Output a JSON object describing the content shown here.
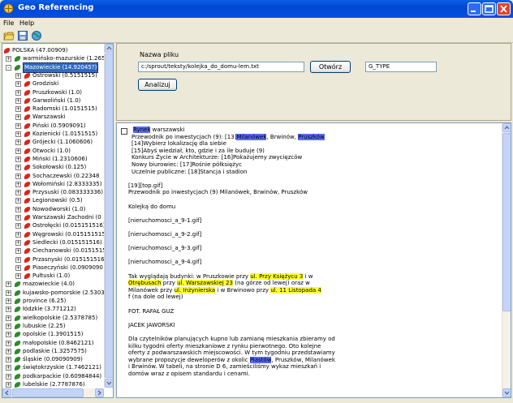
{
  "window": {
    "title": "Geo Referencing"
  },
  "menu": {
    "file": "File",
    "help": "Help"
  },
  "toolbar": {
    "icons": [
      "open-folder-icon",
      "save-icon",
      "globe-icon"
    ]
  },
  "tree": {
    "rows": [
      {
        "label": "POLSKA (47.00909)",
        "level": 0,
        "expander": "",
        "selected": false,
        "icon": "red"
      },
      {
        "label": "warmińsko-mazurskie (1.265",
        "level": 1,
        "expander": "+",
        "selected": false,
        "icon": "green"
      },
      {
        "label": "Mazowieckie (14.92045?)",
        "level": 1,
        "expander": "-",
        "selected": true,
        "icon": "green"
      },
      {
        "label": "Ostrowski (0.5151515)",
        "level": 2,
        "expander": "+",
        "selected": false,
        "icon": "red"
      },
      {
        "label": "Grodziski",
        "level": 2,
        "expander": "+",
        "selected": false,
        "icon": "red"
      },
      {
        "label": "Pruszkowski (1.0)",
        "level": 2,
        "expander": "+",
        "selected": false,
        "icon": "red"
      },
      {
        "label": "Garwoliński (1.0)",
        "level": 2,
        "expander": "+",
        "selected": false,
        "icon": "red"
      },
      {
        "label": "Radomski (1.0151515)",
        "level": 2,
        "expander": "+",
        "selected": false,
        "icon": "red"
      },
      {
        "label": "Warszawski",
        "level": 2,
        "expander": "+",
        "selected": false,
        "icon": "red"
      },
      {
        "label": "Piński (0.5909091)",
        "level": 2,
        "expander": "+",
        "selected": false,
        "icon": "red"
      },
      {
        "label": "Kozienicki (1.0151515)",
        "level": 2,
        "expander": "+",
        "selected": false,
        "icon": "red"
      },
      {
        "label": "Grójecki (1.1060606)",
        "level": 2,
        "expander": "+",
        "selected": false,
        "icon": "red"
      },
      {
        "label": "Otwocki (1.0)",
        "level": 2,
        "expander": "+",
        "selected": false,
        "icon": "red"
      },
      {
        "label": "Miński (1.2310606)",
        "level": 2,
        "expander": "+",
        "selected": false,
        "icon": "red"
      },
      {
        "label": "Sokołowski (0.125)",
        "level": 2,
        "expander": "+",
        "selected": false,
        "icon": "red"
      },
      {
        "label": "Sochaczewski (0.22348",
        "level": 2,
        "expander": "+",
        "selected": false,
        "icon": "red"
      },
      {
        "label": "Wołomiński (2.8333335)",
        "level": 2,
        "expander": "+",
        "selected": false,
        "icon": "red"
      },
      {
        "label": "Przysuski (0.083333336)",
        "level": 2,
        "expander": "+",
        "selected": false,
        "icon": "red"
      },
      {
        "label": "Legionowski (0.5)",
        "level": 2,
        "expander": "+",
        "selected": false,
        "icon": "red"
      },
      {
        "label": "Nowodworski (1.0)",
        "level": 2,
        "expander": "+",
        "selected": false,
        "icon": "red"
      },
      {
        "label": "Warszawski Zachodni (0",
        "level": 2,
        "expander": "+",
        "selected": false,
        "icon": "red"
      },
      {
        "label": "Ostrołęcki (0.015151516)",
        "level": 2,
        "expander": "+",
        "selected": false,
        "icon": "red"
      },
      {
        "label": "Węgrowski (0.015151515",
        "level": 2,
        "expander": "+",
        "selected": false,
        "icon": "red"
      },
      {
        "label": "Siedlecki (0.015151516)",
        "level": 2,
        "expander": "+",
        "selected": false,
        "icon": "red"
      },
      {
        "label": "Ciechanowski (0.0151515",
        "level": 2,
        "expander": "+",
        "selected": false,
        "icon": "red"
      },
      {
        "label": "Przasnyski (0.015151516",
        "level": 2,
        "expander": "+",
        "selected": false,
        "icon": "red"
      },
      {
        "label": "Piaseczyński (0.0909090",
        "level": 2,
        "expander": "+",
        "selected": false,
        "icon": "red"
      },
      {
        "label": "Pułtuski (1.0)",
        "level": 2,
        "expander": "+",
        "selected": false,
        "icon": "red"
      },
      {
        "label": "mazowieckie (4.0)",
        "level": 1,
        "expander": "+",
        "selected": false,
        "icon": "green"
      },
      {
        "label": "kujawsko-pomorskie (2.5303(",
        "level": 1,
        "expander": "+",
        "selected": false,
        "icon": "green"
      },
      {
        "label": "province (6.25)",
        "level": 1,
        "expander": "+",
        "selected": false,
        "icon": "green"
      },
      {
        "label": "łódzkie (3.771212)",
        "level": 1,
        "expander": "+",
        "selected": false,
        "icon": "green"
      },
      {
        "label": "wielkopolskie (2.5378785)",
        "level": 1,
        "expander": "+",
        "selected": false,
        "icon": "green"
      },
      {
        "label": "lubuskie (2.25)",
        "level": 1,
        "expander": "+",
        "selected": false,
        "icon": "green"
      },
      {
        "label": "opolskie (1.3901515)",
        "level": 1,
        "expander": "+",
        "selected": false,
        "icon": "green"
      },
      {
        "label": "małopolskie (0.8462121)",
        "level": 1,
        "expander": "+",
        "selected": false,
        "icon": "green"
      },
      {
        "label": "podlaskie (1.3257575)",
        "level": 1,
        "expander": "+",
        "selected": false,
        "icon": "green"
      },
      {
        "label": "śląskie (0.09090909)",
        "level": 1,
        "expander": "+",
        "selected": false,
        "icon": "green"
      },
      {
        "label": "świętokrzyskie (1.7462121)",
        "level": 1,
        "expander": "+",
        "selected": false,
        "icon": "green"
      },
      {
        "label": "podkarpackie (0.60984844)",
        "level": 1,
        "expander": "+",
        "selected": false,
        "icon": "green"
      },
      {
        "label": "lubelskie (2.7787876)",
        "level": 1,
        "expander": "+",
        "selected": false,
        "icon": "green"
      }
    ]
  },
  "form": {
    "file_label": "Nazwa pliku",
    "file_value": "c:/sprout/teksty/kolejka_do_domu-lem.txt",
    "open_button": "Otwórz",
    "type_value": "G_TYPE",
    "analyze_button": "Analizuj"
  },
  "document": {
    "lines": [
      [
        {
          "t": "Rynek",
          "h": "blue"
        },
        {
          "t": " warszawski",
          "h": ""
        }
      ],
      [
        {
          "t": "Przewodnik po inwestycjach (9): [13]",
          "h": ""
        },
        {
          "t": "Milanówek",
          "h": "blue"
        },
        {
          "t": ", Brwinów, ",
          "h": ""
        },
        {
          "t": "Pruszków",
          "h": "blue"
        }
      ],
      [
        {
          "t": "[14]Wybierz lokalizację dla siebie",
          "h": ""
        }
      ],
      [
        {
          "t": "[15]Abyś wiedział, kto, gdzie i za ile buduje (9)",
          "h": ""
        }
      ],
      [
        {
          "t": "Konkurs Życie w Architekturze: [16]Pokażujemy zwycięzców",
          "h": ""
        }
      ],
      [
        {
          "t": "Nowy biurowiec: [17]Rośnie półksiężyc",
          "h": ""
        }
      ],
      [
        {
          "t": "Uczelnie publiczne: [18]Stancja i stadion",
          "h": ""
        }
      ],
      [
        {
          "t": "",
          "h": ""
        }
      ],
      [
        {
          "t": "[19][top.gif]",
          "h": ""
        }
      ],
      [
        {
          "t": "Przewodnik po inwestycjach (9) Milanówek, Brwinów, Pruszków",
          "h": ""
        }
      ],
      [
        {
          "t": "",
          "h": ""
        }
      ],
      [
        {
          "t": "Kolejką do domu",
          "h": ""
        }
      ],
      [
        {
          "t": "",
          "h": ""
        }
      ],
      [
        {
          "t": "[nieruchomosci_a_9-1.gif]",
          "h": ""
        }
      ],
      [
        {
          "t": "",
          "h": ""
        }
      ],
      [
        {
          "t": "[nieruchomosci_a_9-2.gif]",
          "h": ""
        }
      ],
      [
        {
          "t": "",
          "h": ""
        }
      ],
      [
        {
          "t": "[nieruchomosci_a_9-3.gif]",
          "h": ""
        }
      ],
      [
        {
          "t": "",
          "h": ""
        }
      ],
      [
        {
          "t": "[nieruchomosci_a_9-4.gif]",
          "h": ""
        }
      ],
      [
        {
          "t": "",
          "h": ""
        }
      ],
      [
        {
          "t": "Tak wyglądają budynki: w Pruszkowie przy ",
          "h": ""
        },
        {
          "t": "ul. Przy Księżycu 3",
          "h": "yellow"
        },
        {
          "t": " i w",
          "h": ""
        }
      ],
      [
        {
          "t": "Otrębusach",
          "h": "yellow"
        },
        {
          "t": " przy ",
          "h": ""
        },
        {
          "t": "ul. Warszawskiej 23",
          "h": "yellow"
        },
        {
          "t": " (na górze od lewej) oraz w",
          "h": ""
        }
      ],
      [
        {
          "t": "Milanówek przy ",
          "h": ""
        },
        {
          "t": "ul. Inżynierska",
          "h": "yellow"
        },
        {
          "t": " i w Brwinowo przy ",
          "h": ""
        },
        {
          "t": "ul. 11 Listopada 4",
          "h": "yellow"
        }
      ],
      [
        {
          "t": "f (na dole od lewej)",
          "h": ""
        }
      ],
      [
        {
          "t": "",
          "h": ""
        }
      ],
      [
        {
          "t": "FOT. RAFAŁ GUZ",
          "h": ""
        }
      ],
      [
        {
          "t": "",
          "h": ""
        }
      ],
      [
        {
          "t": "JACEK JAWORSKI",
          "h": ""
        }
      ],
      [
        {
          "t": "",
          "h": ""
        }
      ],
      [
        {
          "t": "Dla czytelników planujących kupno lub zamianę mieszkania zbieramy od",
          "h": ""
        }
      ],
      [
        {
          "t": "kilku tygodni oferty mieszkaniowe z rynku pierwotnego. Oto kolejne",
          "h": ""
        }
      ],
      [
        {
          "t": "oferty z podwarszawskich miejscowości. W tym tygodniu przedstawiamy",
          "h": ""
        }
      ],
      [
        {
          "t": "wybrane propozycje deweloperów z okolic ",
          "h": ""
        },
        {
          "t": "Piastów",
          "h": "blue"
        },
        {
          "t": ", Pruszków, Milanówek",
          "h": ""
        }
      ],
      [
        {
          "t": "i Brwinów. W tabeli, na stronie D 6, zamieściliśmy wykaz mieszkań i",
          "h": ""
        }
      ],
      [
        {
          "t": "domów wraz z opisem standardu i cenami.",
          "h": ""
        }
      ]
    ]
  },
  "colors": {
    "title_bar": "#0A5EE8",
    "selection": "#316AC5",
    "highlight_blue": "#5A6BFF",
    "highlight_yellow": "#FFFF30"
  }
}
